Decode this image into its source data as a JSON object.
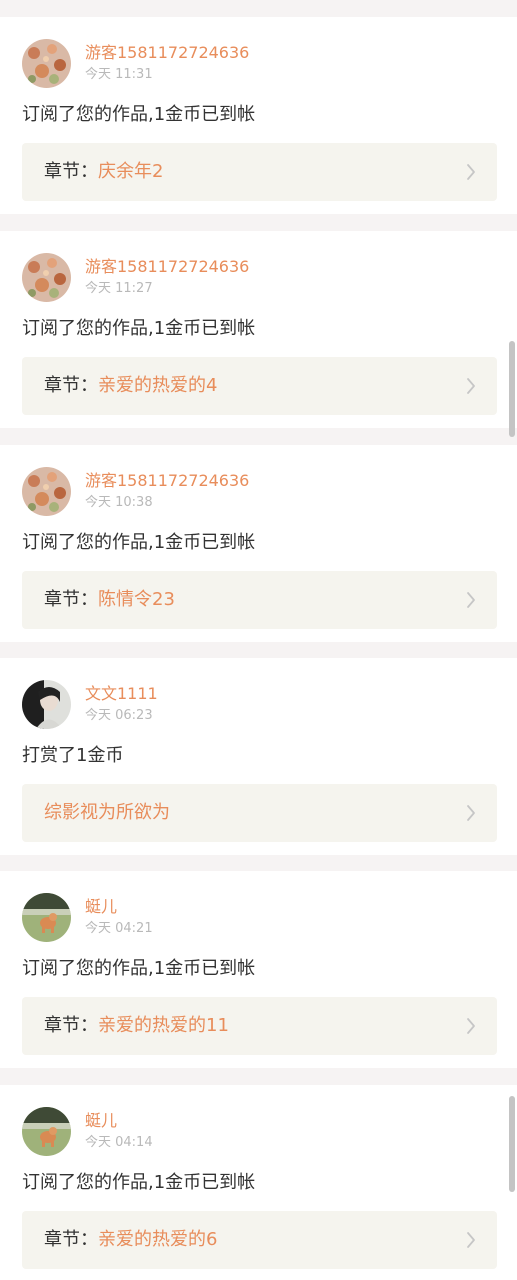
{
  "feed": {
    "items": [
      {
        "username": "游客1581172724636",
        "time": "今天 11:31",
        "message": "订阅了您的作品,1金币已到帐",
        "link_prefix": "章节：",
        "link_title": "庆余年2",
        "avatar_icon": "flower-avatar-icon"
      },
      {
        "username": "游客1581172724636",
        "time": "今天 11:27",
        "message": "订阅了您的作品,1金币已到帐",
        "link_prefix": "章节：",
        "link_title": "亲爱的热爱的4",
        "avatar_icon": "flower-avatar-icon"
      },
      {
        "username": "游客1581172724636",
        "time": "今天 10:38",
        "message": "订阅了您的作品,1金币已到帐",
        "link_prefix": "章节：",
        "link_title": "陈情令23",
        "avatar_icon": "flower-avatar-icon"
      },
      {
        "username": "文文1111",
        "time": "今天 06:23",
        "message": "打赏了1金币",
        "link_prefix": "",
        "link_title": "综影视为所欲为",
        "avatar_icon": "portrait-avatar-icon"
      },
      {
        "username": "蜓儿",
        "time": "今天 04:21",
        "message": "订阅了您的作品,1金币已到帐",
        "link_prefix": "章节：",
        "link_title": "亲爱的热爱的11",
        "avatar_icon": "dog-avatar-icon"
      },
      {
        "username": "蜓儿",
        "time": "今天 04:14",
        "message": "订阅了您的作品,1金币已到帐",
        "link_prefix": "章节：",
        "link_title": "亲爱的热爱的6",
        "avatar_icon": "dog-avatar-icon"
      }
    ]
  },
  "icons": {
    "chevron": "chevron-right-icon"
  },
  "colors": {
    "accent": "#e88d5b",
    "page_background": "#f6f3f3",
    "link_box": "#f5f4ee",
    "timestamp": "#b9b9b9",
    "text": "#333333"
  }
}
